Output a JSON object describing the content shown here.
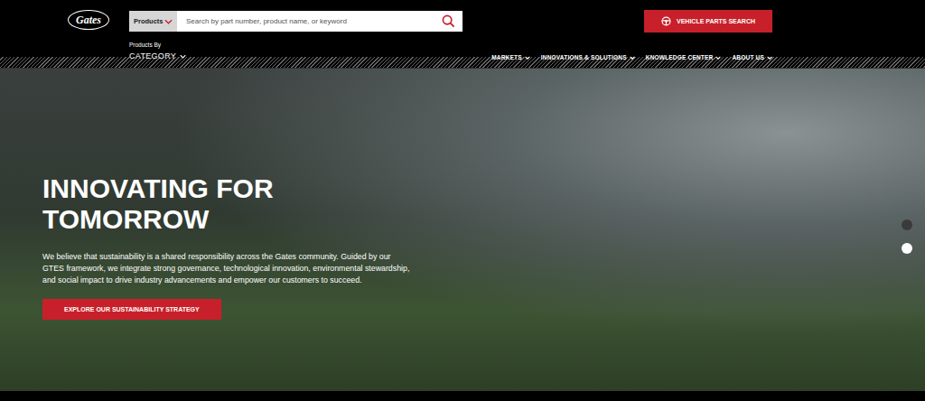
{
  "header": {
    "logo": "Gates",
    "search": {
      "scope": "Products",
      "placeholder": "Search by part number, product name, or keyword"
    },
    "vehicle_button": "VEHICLE PARTS SEARCH",
    "category": {
      "caption": "Products By",
      "label": "CATEGORY"
    }
  },
  "nav": [
    {
      "label": "MARKETS"
    },
    {
      "label": "INNOVATIONS & SOLUTIONS"
    },
    {
      "label": "KNOWLEDGE CENTER"
    },
    {
      "label": "ABOUT US"
    }
  ],
  "hero": {
    "title": "INNOVATING FOR TOMORROW",
    "body": "We believe that sustainability is a shared responsibility across the Gates community. Guided by our GTES framework, we integrate strong governance, technological innovation, environmental stewardship, and social impact to drive industry advancements and empower our customers to succeed.",
    "button": "EXPLORE OUR SUSTAINABILITY STRATEGY"
  },
  "carousel": [
    {
      "selected": false
    },
    {
      "selected": true
    }
  ]
}
